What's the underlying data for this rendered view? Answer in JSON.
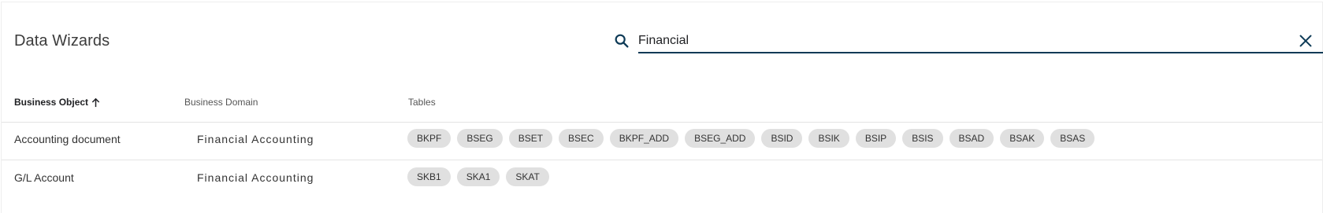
{
  "header": {
    "title": "Data Wizards"
  },
  "search": {
    "value": "Financial",
    "icon": "search-icon",
    "clear_icon": "close-icon"
  },
  "colors": {
    "accent": "#0d3a56",
    "chip_bg": "#e0e0e0",
    "divider": "#e4e4e4"
  },
  "table": {
    "columns": [
      {
        "label": "Business Object",
        "sort": "ascending"
      },
      {
        "label": "Business Domain"
      },
      {
        "label": "Tables"
      }
    ],
    "rows": [
      {
        "business_object": "Accounting document",
        "business_domain": "Financial Accounting",
        "tables": [
          "BKPF",
          "BSEG",
          "BSET",
          "BSEC",
          "BKPF_ADD",
          "BSEG_ADD",
          "BSID",
          "BSIK",
          "BSIP",
          "BSIS",
          "BSAD",
          "BSAK",
          "BSAS"
        ]
      },
      {
        "business_object": "G/L Account",
        "business_domain": "Financial Accounting",
        "tables": [
          "SKB1",
          "SKA1",
          "SKAT"
        ]
      }
    ]
  }
}
